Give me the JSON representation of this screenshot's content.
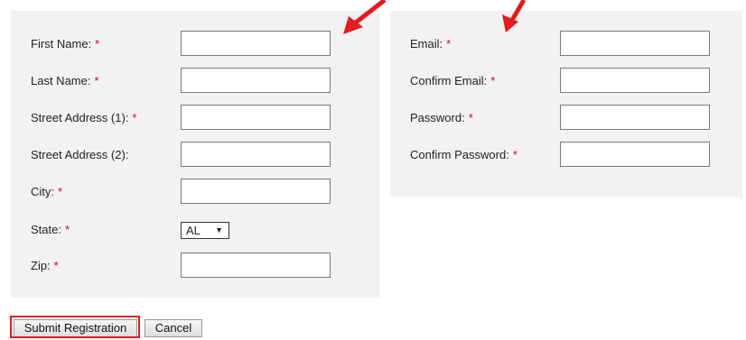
{
  "form": {
    "left_fields": [
      {
        "label": "First Name:",
        "required_mark": "*",
        "value": ""
      },
      {
        "label": "Last Name:",
        "required_mark": "*",
        "value": ""
      },
      {
        "label": "Street Address (1):",
        "required_mark": "*",
        "value": ""
      },
      {
        "label": "Street Address (2):",
        "required_mark": "",
        "value": ""
      },
      {
        "label": "City:",
        "required_mark": "*",
        "value": ""
      },
      {
        "label": "State:",
        "required_mark": "*",
        "selected": "AL"
      },
      {
        "label": "Zip:",
        "required_mark": "*",
        "value": ""
      }
    ],
    "right_fields": [
      {
        "label": "Email:",
        "required_mark": "*",
        "value": ""
      },
      {
        "label": "Confirm Email:",
        "required_mark": "*",
        "value": ""
      },
      {
        "label": "Password:",
        "required_mark": "*",
        "value": ""
      },
      {
        "label": "Confirm Password:",
        "required_mark": "*",
        "value": ""
      }
    ],
    "state_dropdown": {
      "selected": "AL",
      "arrow": "▼"
    }
  },
  "buttons": {
    "submit_label": "Submit Registration",
    "cancel_label": "Cancel"
  },
  "annotations": {
    "arrow_color": "#e11d1d",
    "highlight_color": "#e11d1d"
  },
  "colors": {
    "panel_background": "#f3f1f4",
    "required_asterisk": "#e00000"
  }
}
